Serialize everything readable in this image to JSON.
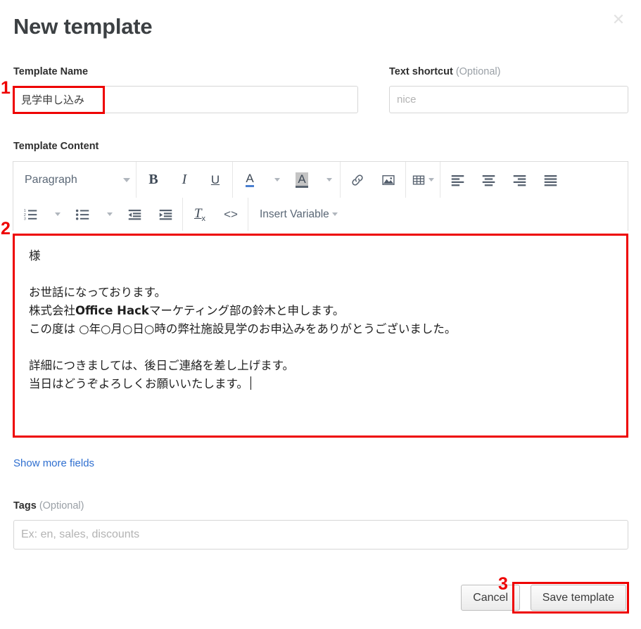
{
  "dialog": {
    "title": "New template",
    "close_icon": "close-icon"
  },
  "fields": {
    "template_name": {
      "label": "Template Name",
      "value": "見学申し込み",
      "placeholder": ""
    },
    "text_shortcut": {
      "label": "Text shortcut",
      "optional_suffix": "(Optional)",
      "value": "",
      "placeholder": "nice"
    },
    "template_content": {
      "label": "Template Content"
    },
    "tags": {
      "label": "Tags",
      "optional_suffix": "(Optional)",
      "value": "",
      "placeholder": "Ex: en, sales, discounts"
    }
  },
  "toolbar": {
    "row1": {
      "paragraph_select": "Paragraph",
      "bold": "B",
      "italic": "I",
      "underline": "U",
      "font_color": "A",
      "highlight_color": "A",
      "link_icon": "link-icon",
      "image_icon": "image-icon",
      "table_icon": "table-icon",
      "align_left_icon": "align-left-icon",
      "align_center_icon": "align-center-icon",
      "align_right_icon": "align-right-icon",
      "align_justify_icon": "align-justify-icon"
    },
    "row2": {
      "ordered_list_icon": "ordered-list-icon",
      "unordered_list_icon": "unordered-list-icon",
      "outdent_icon": "outdent-icon",
      "indent_icon": "indent-icon",
      "clear_format": "Tx",
      "code_view": "<>",
      "insert_variable": "Insert Variable"
    }
  },
  "content": {
    "line1": "様",
    "line2": "",
    "line3": "お世話になっております。",
    "line4_prefix": "株式会社",
    "line4_bold": "Office Hack",
    "line4_suffix": "マーケティング部の鈴木と申します。",
    "line5": "この度は ○年○月○日○時の弊社施設見学のお申込みをありがとうございました。",
    "line6": "",
    "line7": "詳細につきましては、後日ご連絡を差し上げます。",
    "line8": "当日はどうぞよろしくお願いいたします。"
  },
  "links": {
    "show_more_fields": "Show more fields"
  },
  "footer": {
    "cancel_label": "Cancel",
    "save_label": "Save template"
  },
  "annotations": {
    "marker1": "1",
    "marker2": "2",
    "marker3": "3",
    "color": "#ee0000"
  }
}
